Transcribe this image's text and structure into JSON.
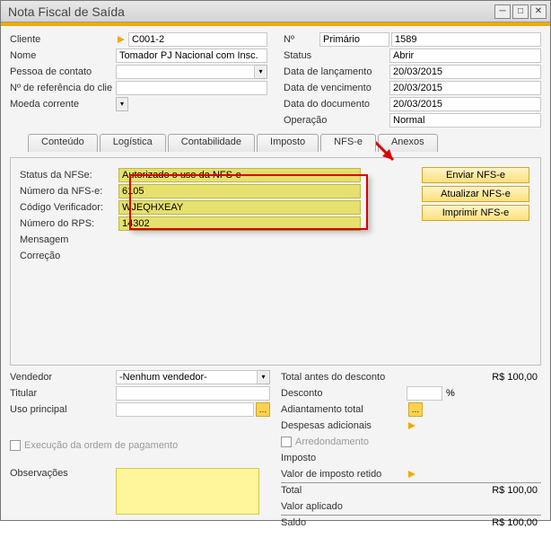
{
  "window": {
    "title": "Nota Fiscal de Saída"
  },
  "header_left": {
    "cliente_lbl": "Cliente",
    "cliente_val": "C001-2",
    "nome_lbl": "Nome",
    "nome_val": "Tomador PJ Nacional com Insc.",
    "contato_lbl": "Pessoa de contato",
    "contato_val": "",
    "refcli_lbl": "Nº de referência do clie",
    "refcli_val": "",
    "moeda_lbl": "Moeda corrente",
    "moeda_val": ""
  },
  "header_right": {
    "num_lbl": "Nº",
    "num_tipo": "Primário",
    "num_val": "1589",
    "status_lbl": "Status",
    "status_val": "Abrir",
    "lanc_lbl": "Data de lançamento",
    "lanc_val": "20/03/2015",
    "venc_lbl": "Data de vencimento",
    "venc_val": "20/03/2015",
    "doc_lbl": "Data do documento",
    "doc_val": "20/03/2015",
    "oper_lbl": "Operação",
    "oper_val": "Normal"
  },
  "tabs": {
    "conteudo": "Conteúdo",
    "logistica": "Logística",
    "contab": "Contabilidade",
    "imposto": "Imposto",
    "nfse": "NFS-e",
    "anexos": "Anexos"
  },
  "nfse": {
    "status_lbl": "Status da NFSe:",
    "status_val": "Autorizado o uso da NFS-e",
    "numero_lbl": "Número da NFS-e:",
    "numero_val": "6105",
    "codver_lbl": "Código Verificador:",
    "codver_val": "WJEQHXEAY",
    "rps_lbl": "Número do RPS:",
    "rps_val": "14302",
    "msg_lbl": "Mensagem",
    "msg_val": "",
    "corr_lbl": "Correção",
    "corr_val": ""
  },
  "nfse_buttons": {
    "enviar": "Enviar NFS-e",
    "atualizar": "Atualizar NFS-e",
    "imprimir": "Imprimir NFS-e"
  },
  "bottom_left": {
    "vend_lbl": "Vendedor",
    "vend_val": "-Nenhum vendedor-",
    "tit_lbl": "Titular",
    "tit_val": "",
    "uso_lbl": "Uso principal",
    "uso_val": "",
    "exec_lbl": "Execução da ordem de pagamento",
    "obs_lbl": "Observações",
    "obs_val": ""
  },
  "bottom_right": {
    "tot_antes_lbl": "Total antes do desconto",
    "tot_antes_val": "R$ 100,00",
    "desc_lbl": "Desconto",
    "desc_pct": "",
    "pct_sym": "%",
    "adiant_lbl": "Adiantamento total",
    "desp_lbl": "Despesas adicionais",
    "arred_lbl": "Arredondamento",
    "imp_lbl": "Imposto",
    "impret_lbl": "Valor de imposto retido",
    "total_lbl": "Total",
    "total_val": "R$ 100,00",
    "vaplic_lbl": "Valor aplicado",
    "saldo_lbl": "Saldo",
    "saldo_val": "R$ 100,00"
  }
}
